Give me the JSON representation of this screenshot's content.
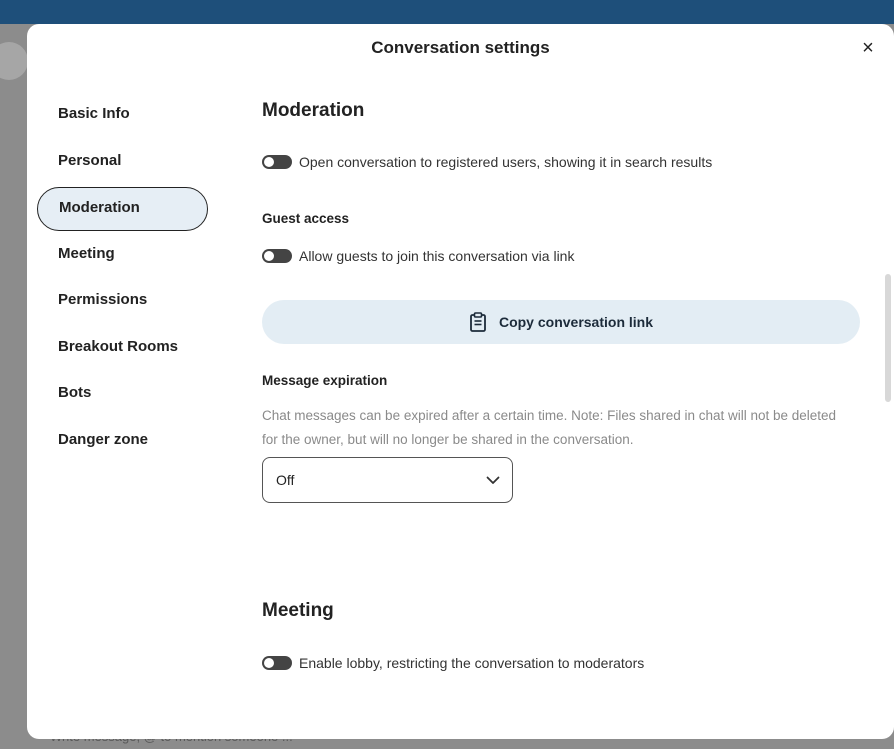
{
  "background": {
    "composer_text": "Write message, @ to mention someone ..."
  },
  "modal": {
    "title": "Conversation settings",
    "close_glyph": "×"
  },
  "nav": {
    "items": [
      {
        "label": "Basic Info"
      },
      {
        "label": "Personal"
      },
      {
        "label": "Moderation",
        "active": true
      },
      {
        "label": "Meeting"
      },
      {
        "label": "Permissions"
      },
      {
        "label": "Breakout Rooms"
      },
      {
        "label": "Bots"
      },
      {
        "label": "Danger zone"
      }
    ]
  },
  "moderation": {
    "heading": "Moderation",
    "open_conversation_label": "Open conversation to registered users, showing it in search results",
    "guest_access": {
      "heading": "Guest access",
      "allow_guests_label": "Allow guests to join this conversation via link",
      "copy_link_button": "Copy conversation link"
    },
    "message_expiration": {
      "heading": "Message expiration",
      "description": "Chat messages can be expired after a certain time. Note: Files shared in chat will not be deleted for the owner, but will no longer be shared in the conversation.",
      "selected": "Off"
    }
  },
  "meeting": {
    "heading": "Meeting",
    "lobby_label": "Enable lobby, restricting the conversation to moderators"
  },
  "colors": {
    "accent_bar": "#1e4f7a",
    "active_nav_bg": "#e6eef5",
    "copy_button_bg": "#e3edf4",
    "toggle_off": "#444444"
  },
  "icons": {
    "clipboard": "clipboard-icon",
    "chevron": "chevron-down-icon",
    "close": "close-icon"
  }
}
